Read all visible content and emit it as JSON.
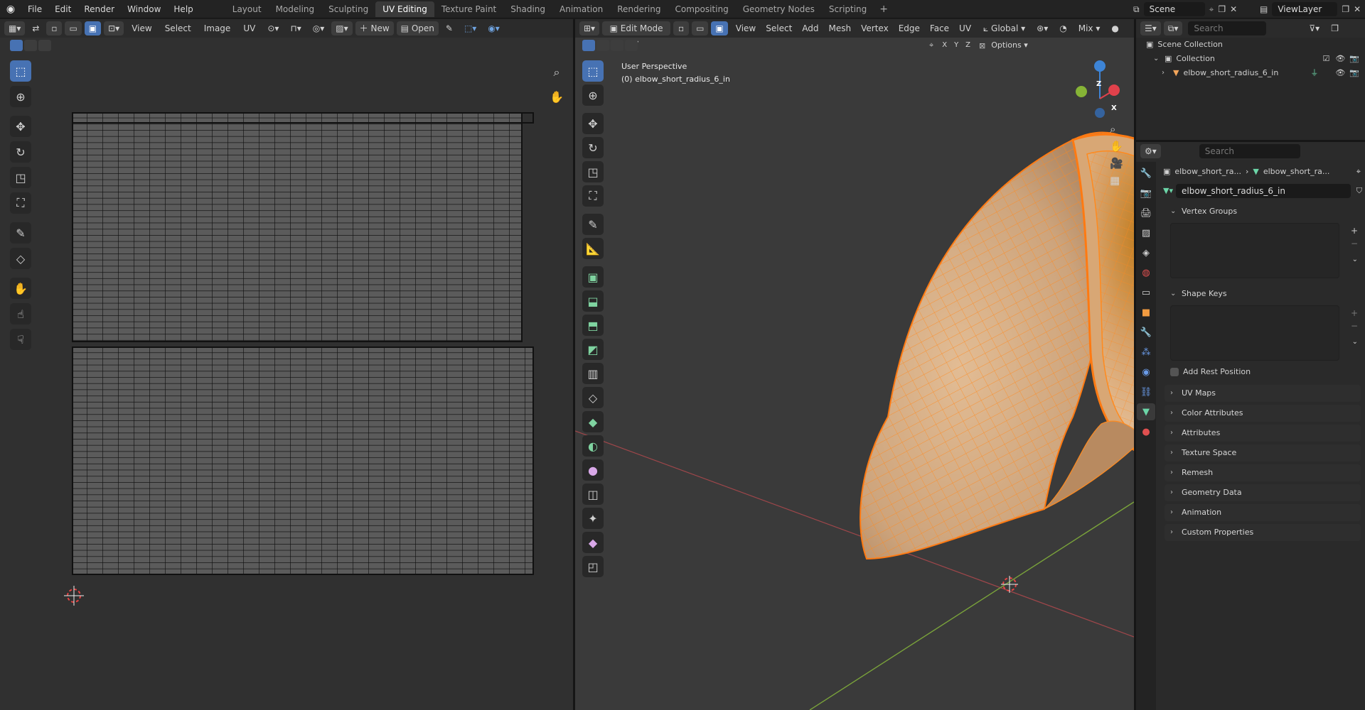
{
  "topbar": {
    "menus": [
      "File",
      "Edit",
      "Render",
      "Window",
      "Help"
    ],
    "workspaces": [
      "Layout",
      "Modeling",
      "Sculpting",
      "UV Editing",
      "Texture Paint",
      "Shading",
      "Animation",
      "Rendering",
      "Compositing",
      "Geometry Nodes",
      "Scripting"
    ],
    "active_workspace": "UV Editing",
    "add_tab": "+",
    "scene": "Scene",
    "view_layer": "ViewLayer"
  },
  "uv_editor": {
    "menus": [
      "View",
      "Select",
      "Image",
      "UV"
    ],
    "new_label": "New",
    "open_label": "Open"
  },
  "viewport": {
    "mode": "Edit Mode",
    "menus": [
      "View",
      "Select",
      "Add",
      "Mesh",
      "Vertex",
      "Edge",
      "Face",
      "UV"
    ],
    "orientation": "Global",
    "blend": "Mix",
    "options_label": "Options",
    "axes": [
      "X",
      "Y",
      "Z"
    ],
    "overlay_title": "User Perspective",
    "overlay_object": "(0) elbow_short_radius_6_in",
    "gizmo": {
      "x": "X",
      "y": "Y",
      "z": "Z"
    }
  },
  "outliner": {
    "search_placeholder": "Search",
    "scene_collection": "Scene Collection",
    "collection": "Collection",
    "object": "elbow_short_radius_6_in"
  },
  "properties": {
    "search_placeholder": "Search",
    "breadcrumb_object": "elbow_short_ra...",
    "breadcrumb_mesh": "elbow_short_ra...",
    "mesh_name": "elbow_short_radius_6_in",
    "vertex_groups": "Vertex Groups",
    "shape_keys": "Shape Keys",
    "add_rest_position": "Add Rest Position",
    "collapsed_sections": [
      "UV Maps",
      "Color Attributes",
      "Attributes",
      "Texture Space",
      "Remesh",
      "Geometry Data",
      "Animation",
      "Custom Properties"
    ]
  },
  "colors": {
    "accent": "#4772b3",
    "mesh_orange": "#ff8a1e",
    "axis_x": "#e0414b",
    "axis_y": "#86b436",
    "axis_z": "#3d84d6"
  }
}
